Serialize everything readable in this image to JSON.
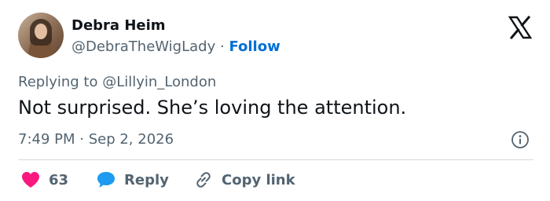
{
  "author": {
    "name": "Debra Heim",
    "handle": "@DebraTheWigLady",
    "separator": "·",
    "follow_label": "Follow"
  },
  "reply_context": {
    "text": "Replying to @Lillyin_London"
  },
  "tweet": {
    "text": "Not surprised. She’s loving the attention.",
    "timestamp": "7:49 PM · Sep 2, 2026"
  },
  "actions": {
    "like_count": "63",
    "reply_label": "Reply",
    "copy_link_label": "Copy link"
  },
  "icons": {
    "platform_logo": "x-logo-icon",
    "info": "info-icon",
    "like": "heart-icon",
    "reply": "speech-bubble-icon",
    "copy_link": "link-icon"
  },
  "colors": {
    "text": "#0f1419",
    "secondary": "#536471",
    "follow": "#006fd6",
    "like": "#f91880",
    "reply": "#1d9bf0"
  }
}
